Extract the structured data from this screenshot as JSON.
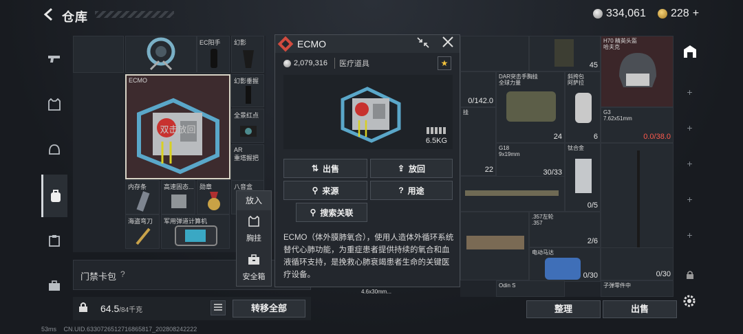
{
  "header": {
    "title": "仓库",
    "currency": [
      {
        "icon": "silver-coin-icon",
        "value": "334,061"
      },
      {
        "icon": "gold-coin-icon",
        "value": "228"
      }
    ],
    "add_label": "+"
  },
  "sidebar": {
    "items": [
      {
        "icon": "pistol-icon",
        "active": false
      },
      {
        "icon": "vest-icon",
        "active": false
      },
      {
        "icon": "helmet-icon",
        "active": false
      },
      {
        "icon": "backpack-icon",
        "active": true
      },
      {
        "icon": "clipboard-icon",
        "active": false
      },
      {
        "icon": "briefcase-icon",
        "active": false
      }
    ]
  },
  "left_panel": {
    "cells": [
      {
        "label": "EC阳手"
      },
      {
        "label": "幻影"
      },
      {
        "label": "幻影垂握"
      },
      {
        "label": "全景红点"
      },
      {
        "label": "AR\n重塔握把"
      },
      {
        "label": "内存条"
      },
      {
        "label": "高速固态..."
      },
      {
        "label": "勋章"
      },
      {
        "label": "八音盒"
      },
      {
        "label": "海盗弯刀"
      },
      {
        "label": "军用弹道计算机"
      }
    ],
    "ecmo_cell": {
      "label": "ECMO",
      "hint": "双击放回"
    }
  },
  "keycard": {
    "label": "门禁卡包",
    "help": "?"
  },
  "weightbar": {
    "current": "64.5",
    "max": "/84千克",
    "transfer_label": "转移全部"
  },
  "putin_menu": {
    "title": "放入",
    "options": [
      {
        "label": "胸挂",
        "icon": "chest-rig-icon"
      },
      {
        "label": "安全箱",
        "icon": "safe-box-icon"
      }
    ]
  },
  "detail": {
    "title": "ECMO",
    "price": "2,079,316",
    "category": "医疗道具",
    "weight": "6.5KG",
    "buttons": {
      "sell": "出售",
      "return": "放回",
      "source": "来源",
      "usage": "用途",
      "search": "搜索关联"
    },
    "description": "ECMO（体外膜肺氧合），使用人造体外循环系统替代心肺功能，为重症患者提供持续的氧合和血液循环支持，是挽救心肺衰竭患者生命的关键医疗设备。"
  },
  "right_grid": {
    "cells": [
      {
        "label": "",
        "count": "45"
      },
      {
        "label": "H70 精英头盔\n哈夫克",
        "count": ""
      },
      {
        "label": "",
        "count": "0/142.0"
      },
      {
        "label": "DAR突击手胸挂\n全球力量",
        "count": "24"
      },
      {
        "label": "斜挎包\n阿萨拉",
        "count": "6"
      },
      {
        "label": "G3\n7.62x51mm",
        "count": "0.0/38.0"
      },
      {
        "label": "挂",
        "count": "22"
      },
      {
        "label": "G18\n9x19mm",
        "count": "30/33"
      },
      {
        "label": "钛合金",
        "count": "0/5"
      },
      {
        "label": ".357左轮\n.357",
        "count": "2/6"
      },
      {
        "label": "电动马达",
        "count": ""
      },
      {
        "label": "",
        "count": "0/30"
      },
      {
        "label": "",
        "count": "0/30"
      },
      {
        "label": "Odin S",
        "count": ""
      },
      {
        "label": "子弹零件中",
        "count": ""
      },
      {
        "label": "4.6x30mm...",
        "count": ""
      }
    ]
  },
  "bottom": {
    "organize_label": "整理",
    "sell_label": "出售"
  },
  "status": {
    "ping": "53ms",
    "uid": "CN.UID.6330726512716865817_202808242222"
  },
  "colors": {
    "accent_red": "#d24b3f",
    "bg": "#1b1f24",
    "panel": "#23272d",
    "highlight_cell": "#3d2b2e"
  }
}
